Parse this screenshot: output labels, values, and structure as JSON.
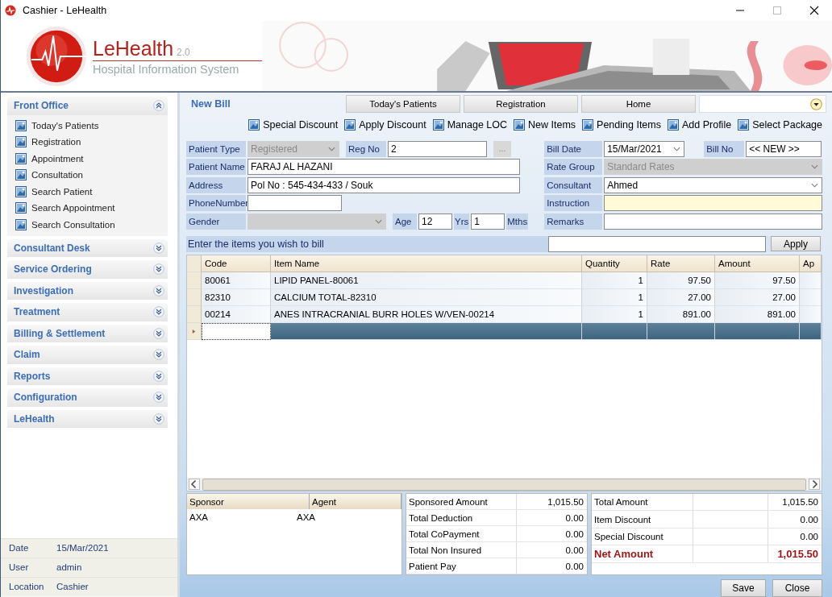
{
  "window": {
    "title": "Cashier - LeHealth"
  },
  "banner": {
    "brand": "LeHealth",
    "version": "2.0",
    "tagline": "Hospital Information System"
  },
  "sidebar": {
    "sections": [
      {
        "title": "Front Office",
        "expanded": true,
        "items": [
          "Today's Patients",
          "Registration",
          "Appointment",
          "Consultation",
          "Search Patient",
          "Search Appointment",
          "Search Consultation"
        ]
      },
      {
        "title": "Consultant Desk",
        "expanded": false
      },
      {
        "title": "Service Ordering",
        "expanded": false
      },
      {
        "title": "Investigation",
        "expanded": false
      },
      {
        "title": "Treatment",
        "expanded": false
      },
      {
        "title": "Billing & Settlement",
        "expanded": false
      },
      {
        "title": "Claim",
        "expanded": false
      },
      {
        "title": "Reports",
        "expanded": false
      },
      {
        "title": "Configuration",
        "expanded": false
      },
      {
        "title": "LeHealth",
        "expanded": false
      }
    ],
    "info": [
      {
        "label": "Date",
        "value": "15/Mar/2021"
      },
      {
        "label": "User",
        "value": "admin"
      },
      {
        "label": "Location",
        "value": "Cashier"
      }
    ]
  },
  "page": {
    "title": "New Bill",
    "tabs": [
      {
        "label": "Today's Patients",
        "selected": false
      },
      {
        "label": "Registration",
        "selected": false
      },
      {
        "label": "Home",
        "selected": false
      }
    ]
  },
  "toolbar": [
    "Special Discount",
    "Apply Discount",
    "Manage LOC",
    "New Items",
    "Pending Items",
    "Add Profile",
    "Select Package"
  ],
  "patient_form": {
    "patient_type": {
      "label": "Patient Type",
      "value": "Registered",
      "disabled": true
    },
    "reg_no": {
      "label": "Reg No",
      "value": "2",
      "button": "..."
    },
    "patient_name": {
      "label": "Patient Name",
      "value": "FARAJ AL HAZANI"
    },
    "address": {
      "label": "Address",
      "value": "Pol No : 545-434-433 / Souk"
    },
    "phone": {
      "label": "PhoneNumber"
    },
    "gender": {
      "label": "Gender",
      "disabled": true
    },
    "age": {
      "label": "Age",
      "years": "12",
      "years_unit": "Yrs",
      "months": "1",
      "months_unit": "Mths"
    }
  },
  "bill_form": {
    "bill_date": {
      "label": "Bill Date",
      "value": "15/Mar/2021"
    },
    "bill_no": {
      "label": "Bill No",
      "value": "<< NEW >>"
    },
    "rate_group": {
      "label": "Rate Group",
      "value": "Standard Rates",
      "disabled": true
    },
    "consultant": {
      "label": "Consultant",
      "value": "Ahmed",
      "disabled": false
    },
    "instruction": {
      "label": "Instruction"
    },
    "remarks": {
      "label": "Remarks"
    }
  },
  "item_entry": {
    "prompt": "Enter the items you wish to bill",
    "button": "Apply"
  },
  "items_table": {
    "columns": [
      "Code",
      "Item Name",
      "Quantity",
      "Rate",
      "Amount",
      "Ap"
    ],
    "rows": [
      [
        "80061",
        "LIPID PANEL-80061",
        "1",
        "97.50",
        "97.50"
      ],
      [
        "82310",
        "CALCIUM TOTAL-82310",
        "1",
        "27.00",
        "27.00"
      ],
      [
        "00214",
        "ANES INTRACRANIAL BURR HOLES W/VEN-00214",
        "1",
        "891.00",
        "891.00"
      ]
    ]
  },
  "sponsors": {
    "columns": [
      "Sponsor",
      "Agent"
    ],
    "rows": [
      [
        "AXA",
        "AXA"
      ]
    ]
  },
  "coverage": [
    {
      "label": "Sponsored Amount",
      "value": "1,015.50"
    },
    {
      "label": "Total Deduction",
      "value": "0.00"
    },
    {
      "label": "Total CoPayment",
      "value": "0.00"
    },
    {
      "label": "Total Non Insured",
      "value": "0.00"
    },
    {
      "label": "Patient Pay",
      "value": "0.00"
    }
  ],
  "totals": [
    {
      "label": "Total Amount",
      "value": "1,015.50",
      "kind": "normal"
    },
    {
      "label": "Item Discount",
      "value": "0.00",
      "kind": "normal"
    },
    {
      "label": "Special Discount",
      "value": "0.00",
      "kind": "normal"
    },
    {
      "label": "Net Amount",
      "value": "1,015.50",
      "kind": "net"
    }
  ],
  "buttons": [
    "Save",
    "Close"
  ]
}
